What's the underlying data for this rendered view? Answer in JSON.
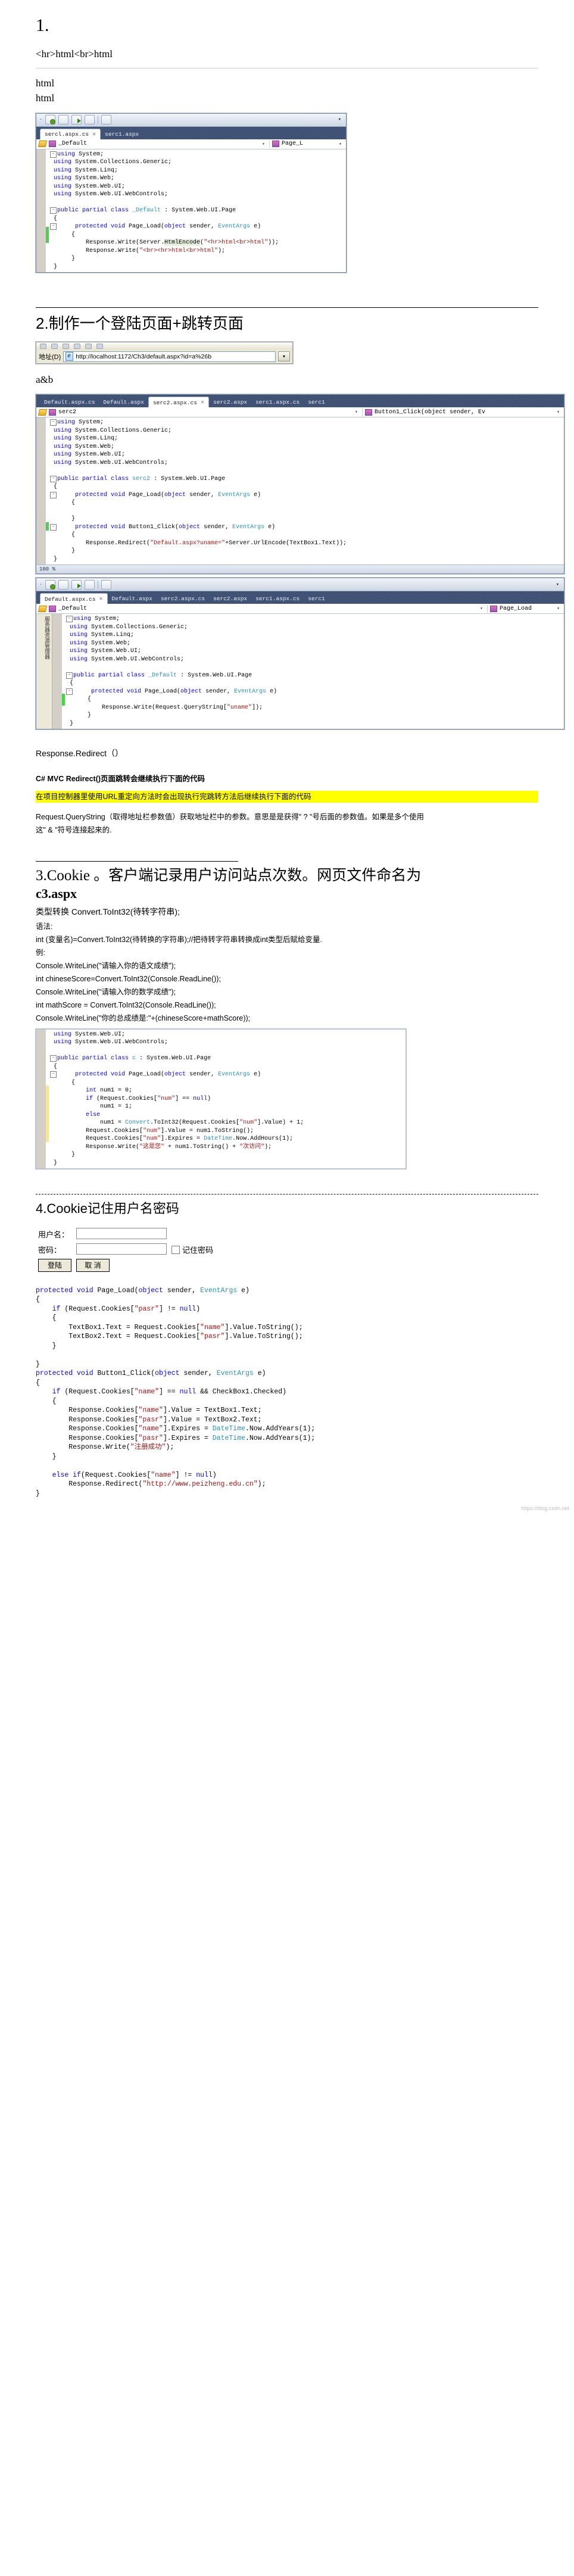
{
  "sections": {
    "s1": {
      "number": "1.",
      "browser_output_line": "<hr>html<br>html",
      "rendered_line1": "html",
      "rendered_line2": "html"
    },
    "s2": {
      "heading": "2.制作一个登陆页面+跳转页面",
      "address_label": "地址(D)",
      "address_value": "http://localhost:1172/Ch3/default.aspx?id=a%26b",
      "output_text": "a&b"
    },
    "s2_notes": {
      "redirect_sig": "Response.Redirect（）",
      "mvc_title": "C# MVC Redirect()页面跳转会继续执行下面的代码",
      "highlight": "在项目控制器里使用URL重定向方法时会出现执行完跳转方法后继续执行下面的代码",
      "query_note_1": "Request.QueryString（取得地址栏参数值）获取地址栏中的参数。意思是是获得\" ? \"号后面的参数值。如果是多个使用",
      "query_note_2": "这\" & \"符号连接起来的."
    },
    "s3": {
      "heading": "3.Cookie 。客户端记录用户访问站点次数。网页文件命名为",
      "filename": "c3.aspx",
      "line_convert": "类型转换 Convert.ToInt32(待转字符串);",
      "line_syntax": "语法:",
      "line_decl": "int (变量名)=Convert.ToInt32(待转换的字符串);//把待转字符串转换成int类型后赋给变量.",
      "line_ex1": "例:",
      "line_ex2": "Console.WriteLine(\"请输入你的语文成绩\");",
      "line_ex3": "int chineseScore=Convert.ToInt32(Console.ReadLine());",
      "line_ex4": "Console.WriteLine(\"请输入你的数学成绩\");",
      "line_ex5": "int mathScore = Convert.ToInt32(Console.ReadLine());",
      "line_ex6": "Console.WriteLine(\"你的总成绩是:\"+(chineseScore+mathScore));"
    },
    "s4": {
      "heading": "4.Cookie记住用户名密码",
      "label_user": "用户名：",
      "label_pass": "密码：",
      "label_remember": "记住密码",
      "btn_login": "登陆",
      "btn_cancel": "取 消",
      "input_user_value": "",
      "input_pass_value": ""
    }
  },
  "vs1": {
    "toolbar_icons": [
      "new-item-icon",
      "undo-icon",
      "run-icon",
      "copy-icon",
      "wrench-icon"
    ],
    "tabs": [
      {
        "label": "sercl.aspx.cs",
        "active": true,
        "close": "✕"
      },
      {
        "label": "serc1.aspx",
        "active": false
      }
    ],
    "nav_left": "_Default",
    "nav_right": "Page_L",
    "code": [
      {
        "t": "fold",
        "s": "using System;"
      },
      {
        "t": "n",
        "s": "using System.Collections.Generic;"
      },
      {
        "t": "n",
        "s": "using System.Linq;"
      },
      {
        "t": "n",
        "s": "using System.Web;"
      },
      {
        "t": "n",
        "s": "using System.Web.UI;"
      },
      {
        "t": "n",
        "s": "using System.Web.UI.WebControls;"
      },
      {
        "t": "blank",
        "s": ""
      },
      {
        "t": "fold",
        "s": "public partial class _Default : System.Web.UI.Page"
      },
      {
        "t": "n",
        "s": "{"
      },
      {
        "t": "fold2",
        "s": "    protected void Page_Load(object sender, EventArgs e)"
      },
      {
        "t": "n",
        "s": "    {"
      },
      {
        "t": "n",
        "s": "        Response.Write(Server.HtmlEncode(\"<hr>html<br>html\"));"
      },
      {
        "t": "n",
        "s": "        Response.Write(\"<br><hr>html<br>html\");"
      },
      {
        "t": "n",
        "s": "    }"
      },
      {
        "t": "n",
        "s": "}"
      }
    ]
  },
  "vs2": {
    "tabs": [
      {
        "label": "Default.aspx.cs",
        "active": false
      },
      {
        "label": "Default.aspx",
        "active": false
      },
      {
        "label": "serc2.aspx.cs",
        "active": true,
        "close": "✕"
      },
      {
        "label": "serc2.aspx",
        "active": false
      },
      {
        "label": "serc1.aspx.cs",
        "active": false
      },
      {
        "label": "serc1",
        "active": false
      }
    ],
    "nav_left": "serc2",
    "nav_right": "Button1_Click(object sender, Ev",
    "code": [
      {
        "t": "fold",
        "s": "using System;"
      },
      {
        "t": "n",
        "s": "using System.Collections.Generic;"
      },
      {
        "t": "n",
        "s": "using System.Linq;"
      },
      {
        "t": "n",
        "s": "using System.Web;"
      },
      {
        "t": "n",
        "s": "using System.Web.UI;"
      },
      {
        "t": "n",
        "s": "using System.Web.UI.WebControls;"
      },
      {
        "t": "blank",
        "s": ""
      },
      {
        "t": "fold",
        "s": "public partial class serc2 : System.Web.UI.Page"
      },
      {
        "t": "n",
        "s": "{"
      },
      {
        "t": "fold2",
        "s": "    protected void Page_Load(object sender, EventArgs e)"
      },
      {
        "t": "n",
        "s": "    {"
      },
      {
        "t": "blank",
        "s": ""
      },
      {
        "t": "n",
        "s": "    }"
      },
      {
        "t": "fold2",
        "s": "    protected void Button1_Click(object sender, EventArgs e)"
      },
      {
        "t": "n",
        "s": "    {"
      },
      {
        "t": "n",
        "s": "        Response.Redirect(\"Default.aspx?uname=\"+Server.UrlEncode(TextBox1.Text));"
      },
      {
        "t": "n",
        "s": "    }"
      },
      {
        "t": "n",
        "s": "}"
      }
    ],
    "status": "100 %"
  },
  "vs3": {
    "tabs": [
      {
        "label": "Default.aspx.cs",
        "active": true,
        "close": "✕"
      },
      {
        "label": "Default.aspx",
        "active": false
      },
      {
        "label": "serc2.aspx.cs",
        "active": false
      },
      {
        "label": "serc2.aspx",
        "active": false
      },
      {
        "label": "serc1.aspx.cs",
        "active": false
      },
      {
        "label": "serc1",
        "active": false
      }
    ],
    "nav_left": "_Default",
    "nav_right": "Page_Load",
    "sidebar_text": "服务器资源管理器",
    "code": [
      {
        "t": "fold",
        "s": "using System;"
      },
      {
        "t": "n",
        "s": "using System.Collections.Generic;"
      },
      {
        "t": "n",
        "s": "using System.Linq;"
      },
      {
        "t": "n",
        "s": "using System.Web;"
      },
      {
        "t": "n",
        "s": "using System.Web.UI;"
      },
      {
        "t": "n",
        "s": "using System.Web.UI.WebControls;"
      },
      {
        "t": "blank",
        "s": ""
      },
      {
        "t": "fold",
        "s": "public partial class _Default : System.Web.UI.Page"
      },
      {
        "t": "n",
        "s": "{"
      },
      {
        "t": "fold2",
        "s": "    protected void Page_Load(object sender, EventArgs e)"
      },
      {
        "t": "n",
        "s": "    {"
      },
      {
        "t": "n",
        "s": "        Response.Write(Request.QueryString[\"uname\"]);"
      },
      {
        "t": "n",
        "s": "    }"
      },
      {
        "t": "n",
        "s": "}"
      }
    ]
  },
  "vs4": {
    "code": [
      {
        "t": "n",
        "s": "using System.Web.UI;"
      },
      {
        "t": "n",
        "s": "using System.Web.UI.WebControls;"
      },
      {
        "t": "blank",
        "s": ""
      },
      {
        "t": "fold",
        "s": "public partial class c : System.Web.UI.Page"
      },
      {
        "t": "n",
        "s": "{"
      },
      {
        "t": "fold2",
        "s": "    protected void Page_Load(object sender, EventArgs e)"
      },
      {
        "t": "n",
        "s": "    {"
      },
      {
        "t": "n",
        "s": "        int num1 = 0;"
      },
      {
        "t": "n",
        "s": "        if (Request.Cookies[\"num\"] == null)"
      },
      {
        "t": "n",
        "s": "            num1 = 1;"
      },
      {
        "t": "n",
        "s": "        else"
      },
      {
        "t": "n",
        "s": "            num1 = Convert.ToInt32(Request.Cookies[\"num\"].Value) + 1;"
      },
      {
        "t": "n",
        "s": "        Request.Cookies[\"num\"].Value = num1.ToString();"
      },
      {
        "t": "n",
        "s": "        Request.Cookies[\"num\"].Expires = DateTime.Now.AddHours(1);"
      },
      {
        "t": "n",
        "s": "        Response.Write(\"这是您\" + num1.ToString() + \"次访问\");"
      },
      {
        "t": "n",
        "s": "    }"
      },
      {
        "t": "n",
        "s": "}"
      }
    ]
  },
  "code4": {
    "lines": [
      {
        "s": "protected void Page_Load(object sender, EventArgs e)"
      },
      {
        "s": "{"
      },
      {
        "s": "    if (Request.Cookies[\"pasr\"] != null)"
      },
      {
        "s": "    {"
      },
      {
        "s": "        TextBox1.Text = Request.Cookies[\"name\"].Value.ToString();"
      },
      {
        "s": "        TextBox2.Text = Request.Cookies[\"pasr\"].Value.ToString();"
      },
      {
        "s": "    }"
      },
      {
        "s": ""
      },
      {
        "s": "}"
      },
      {
        "s": "protected void Button1_Click(object sender, EventArgs e)"
      },
      {
        "s": "{"
      },
      {
        "s": "    if (Request.Cookies[\"name\"] == null && CheckBox1.Checked)"
      },
      {
        "s": "    {"
      },
      {
        "s": "        Response.Cookies[\"name\"].Value = TextBox1.Text;"
      },
      {
        "s": "        Response.Cookies[\"pasr\"].Value = TextBox2.Text;"
      },
      {
        "s": "        Response.Cookies[\"name\"].Expires = DateTime.Now.AddYears(1);"
      },
      {
        "s": "        Response.Cookies[\"pasr\"].Expires = DateTime.Now.AddYears(1);"
      },
      {
        "s": "        Response.Write(\"注册成功\");"
      },
      {
        "s": "    }"
      },
      {
        "s": ""
      },
      {
        "s": "    else if(Request.Cookies[\"name\"] != null)"
      },
      {
        "s": "        Response.Redirect(\"http://www.peizheng.edu.cn\");"
      },
      {
        "s": "}"
      }
    ]
  },
  "watermark": "https://blog.csdn.net"
}
